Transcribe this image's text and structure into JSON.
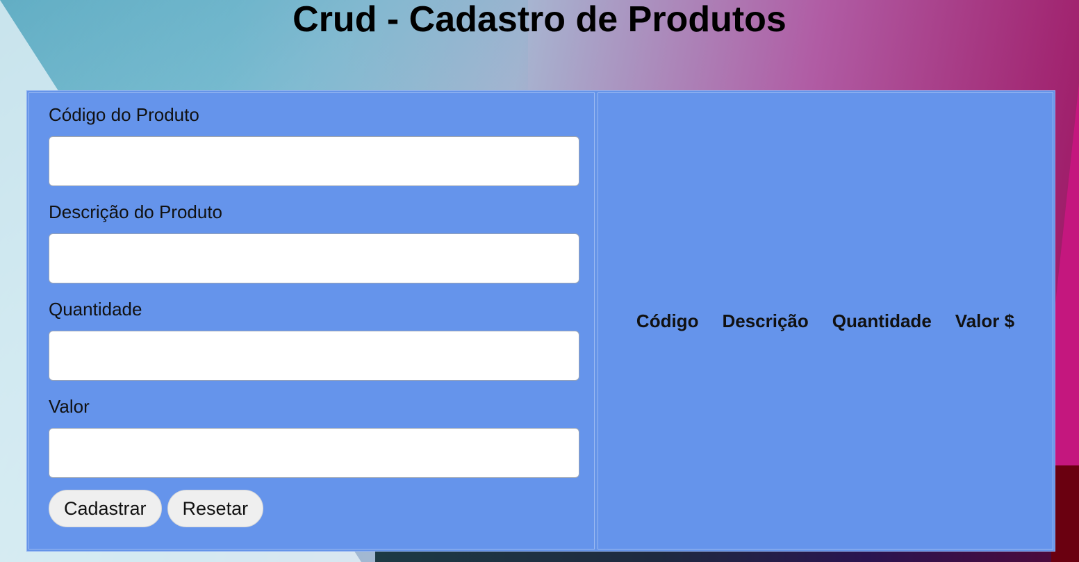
{
  "page": {
    "title": "Crud - Cadastro de Produtos"
  },
  "form": {
    "fields": [
      {
        "label": "Código do Produto",
        "value": "",
        "placeholder": ""
      },
      {
        "label": "Descrição do Produto",
        "value": "",
        "placeholder": ""
      },
      {
        "label": "Quantidade",
        "value": "",
        "placeholder": ""
      },
      {
        "label": "Valor",
        "value": "",
        "placeholder": ""
      }
    ],
    "buttons": {
      "submit_label": "Cadastrar",
      "reset_label": "Resetar"
    }
  },
  "table": {
    "headers": [
      "Código",
      "Descrição",
      "Quantidade",
      "Valor $"
    ],
    "rows": []
  },
  "colors": {
    "panel": "#6594eb",
    "button": "#efefef"
  }
}
